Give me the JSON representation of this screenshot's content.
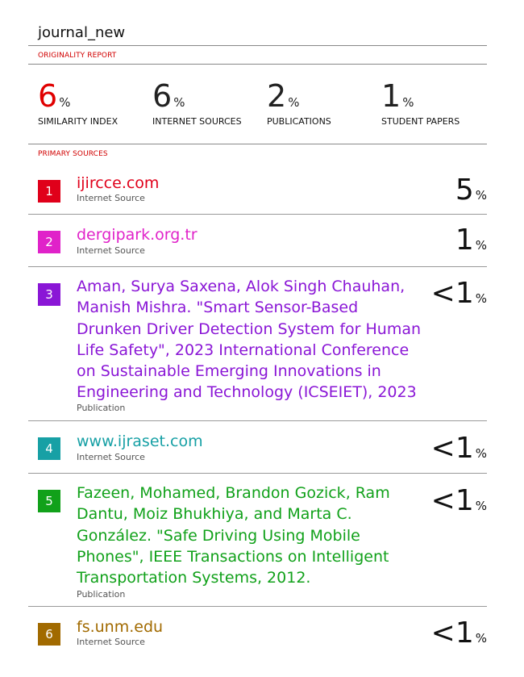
{
  "document": {
    "title": "journal_new"
  },
  "report": {
    "header": "ORIGINALITY REPORT",
    "stats": [
      {
        "value": "6",
        "unit": "%",
        "label": "SIMILARITY INDEX",
        "color": "#e00000"
      },
      {
        "value": "6",
        "unit": "%",
        "label": "INTERNET SOURCES",
        "color": "#111111"
      },
      {
        "value": "2",
        "unit": "%",
        "label": "PUBLICATIONS",
        "color": "#111111"
      },
      {
        "value": "1",
        "unit": "%",
        "label": "STUDENT PAPERS",
        "color": "#111111"
      }
    ]
  },
  "primary": {
    "header": "PRIMARY SOURCES",
    "sources": [
      {
        "rank": "1",
        "title": "ijircce.com",
        "type": "Internet Source",
        "percent": "5",
        "unit": "%",
        "color": "#e0001a"
      },
      {
        "rank": "2",
        "title": "dergipark.org.tr",
        "type": "Internet Source",
        "percent": "1",
        "unit": "%",
        "color": "#e022c9"
      },
      {
        "rank": "3",
        "title": "Aman, Surya Saxena, Alok Singh Chauhan, Manish Mishra. \"Smart Sensor-Based Drunken Driver Detection System for Human Life Safety\", 2023 International Conference on Sustainable Emerging Innovations in Engineering and Technology (ICSEIET), 2023",
        "type": "Publication",
        "percent": "<1",
        "unit": "%",
        "color": "#8a16d6"
      },
      {
        "rank": "4",
        "title": "www.ijraset.com",
        "type": "Internet Source",
        "percent": "<1",
        "unit": "%",
        "color": "#17a0a5"
      },
      {
        "rank": "5",
        "title": "Fazeen, Mohamed, Brandon Gozick, Ram Dantu, Moiz Bhukhiya, and Marta C. González. \"Safe Driving Using Mobile Phones\", IEEE Transactions on Intelligent Transportation Systems, 2012.",
        "type": "Publication",
        "percent": "<1",
        "unit": "%",
        "color": "#11a11a"
      },
      {
        "rank": "6",
        "title": "fs.unm.edu",
        "type": "Internet Source",
        "percent": "<1",
        "unit": "%",
        "color": "#a16a00"
      }
    ]
  }
}
